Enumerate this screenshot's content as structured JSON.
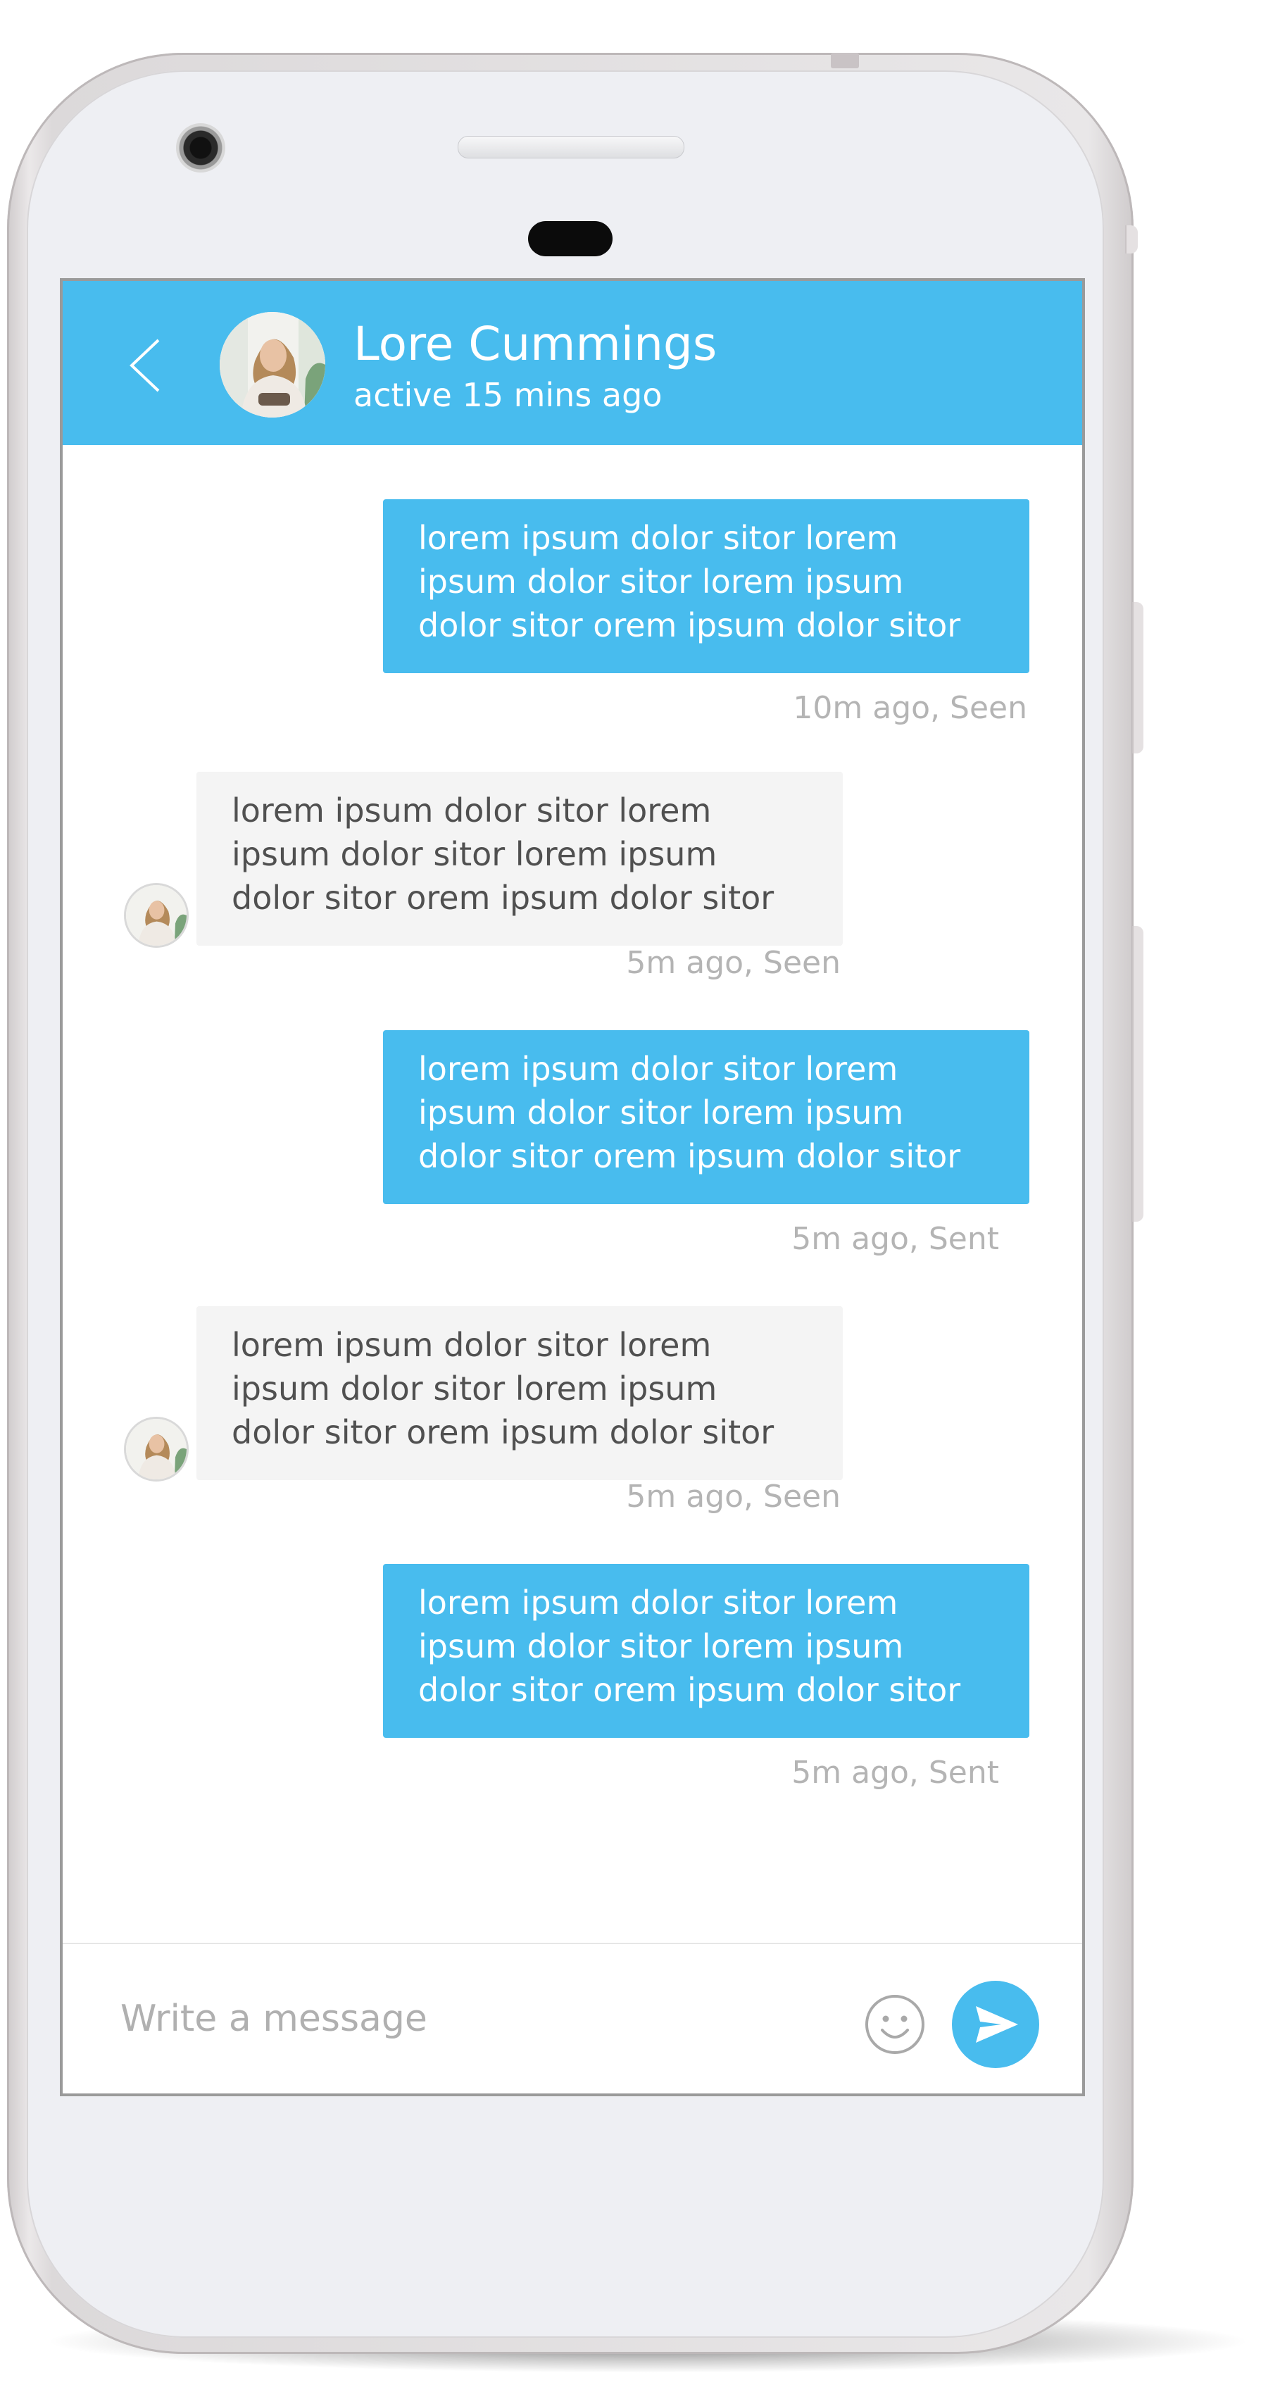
{
  "header": {
    "contact_name": "Lore Cummings",
    "status": "active 15 mins ago"
  },
  "messages": [
    {
      "direction": "outgoing",
      "text": "lorem ipsum dolor sitor lorem\nipsum dolor sitor lorem ipsum\ndolor sitor orem ipsum dolor sitor",
      "meta": "10m ago, Seen"
    },
    {
      "direction": "incoming",
      "text": "lorem ipsum dolor sitor lorem\nipsum dolor sitor lorem ipsum\ndolor sitor orem ipsum dolor sitor",
      "meta": "5m ago, Seen"
    },
    {
      "direction": "outgoing",
      "text": "lorem ipsum dolor sitor lorem\nipsum dolor sitor lorem ipsum\ndolor sitor orem ipsum dolor sitor",
      "meta": "5m ago, Sent"
    },
    {
      "direction": "incoming",
      "text": "lorem ipsum dolor sitor lorem\nipsum dolor sitor lorem ipsum\ndolor sitor orem ipsum dolor sitor",
      "meta": "5m ago, Seen"
    },
    {
      "direction": "outgoing",
      "text": "lorem ipsum dolor sitor lorem\nipsum dolor sitor lorem ipsum\ndolor sitor orem ipsum dolor sitor",
      "meta": "5m ago, Sent"
    }
  ],
  "composer": {
    "placeholder": "Write a message",
    "value": ""
  },
  "icons": {
    "back": "chevron-left-icon",
    "emoji": "smiley-icon",
    "send": "paper-plane-icon"
  },
  "colors": {
    "accent": "#48bcee",
    "incoming_bubble": "#f4f4f4",
    "meta_text": "#b4b4b4"
  }
}
